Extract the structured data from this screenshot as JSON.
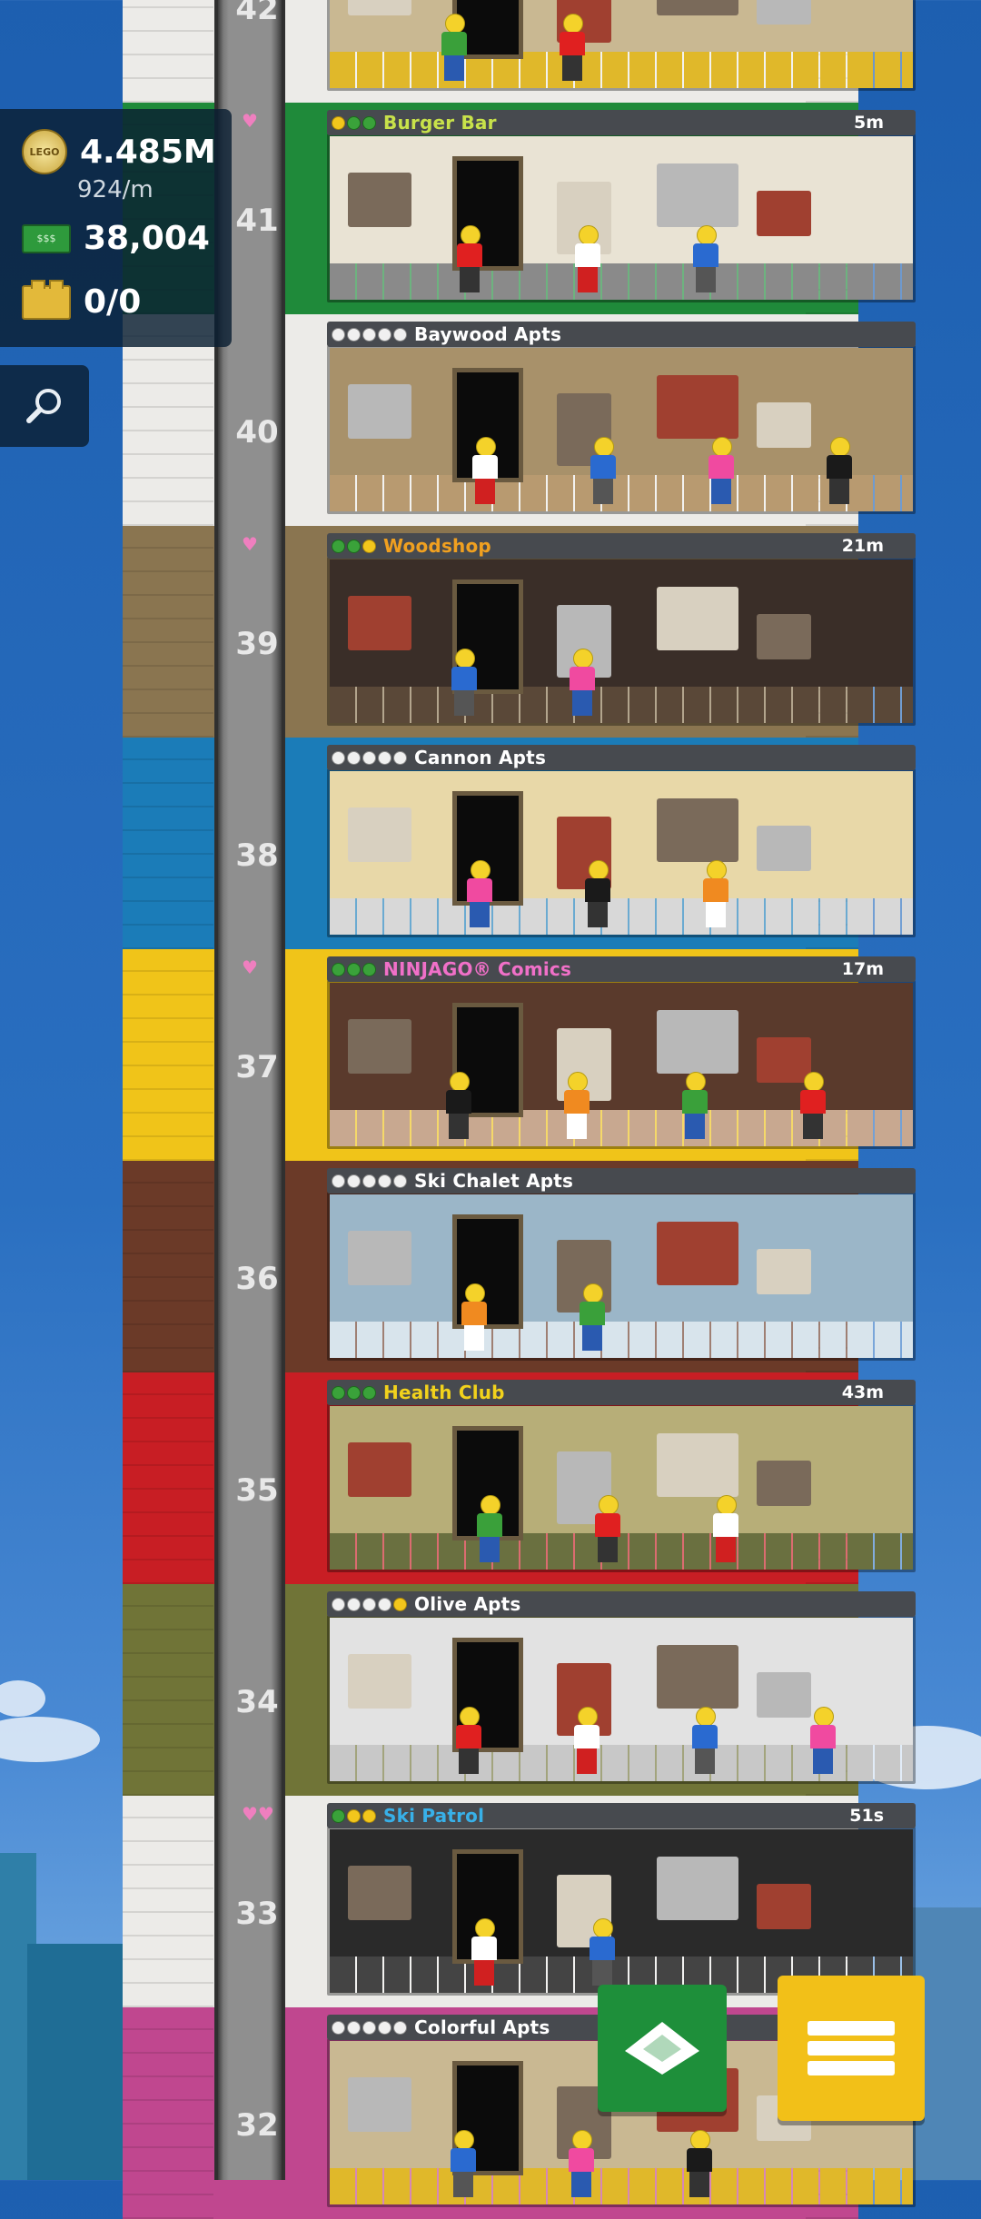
{
  "hud": {
    "coins": "4.485M",
    "coin_rate": "924/m",
    "bux": "38,004",
    "bricks": "0/0",
    "coin_icon_text": "LEGO",
    "bill_icon_text": "$$$"
  },
  "floors": [
    {
      "number": "42",
      "name": "",
      "timer": "",
      "stars": [],
      "theme": "white",
      "hearts": ""
    },
    {
      "number": "41",
      "name": "Burger Bar",
      "timer": "5m",
      "stars": [
        "y",
        "g",
        "g"
      ],
      "theme": "green",
      "name_color": "#c8e24a",
      "hearts": "♥"
    },
    {
      "number": "40",
      "name": "Baywood Apts",
      "timer": "",
      "stars": [
        "w",
        "w",
        "w",
        "w",
        "w"
      ],
      "theme": "white",
      "name_color": "#ffffff",
      "hearts": ""
    },
    {
      "number": "39",
      "name": "Woodshop",
      "timer": "21m",
      "stars": [
        "g",
        "g",
        "y"
      ],
      "theme": "tan",
      "name_color": "#f0a020",
      "hearts": "♥"
    },
    {
      "number": "38",
      "name": "Cannon Apts",
      "timer": "",
      "stars": [
        "w",
        "w",
        "w",
        "w",
        "w"
      ],
      "theme": "blue",
      "name_color": "#ffffff",
      "hearts": ""
    },
    {
      "number": "37",
      "name": "NINJAGO® Comics",
      "timer": "17m",
      "stars": [
        "g",
        "g",
        "g"
      ],
      "theme": "yellow",
      "name_color": "#f070c8",
      "hearts": "♥"
    },
    {
      "number": "36",
      "name": "Ski Chalet Apts",
      "timer": "",
      "stars": [
        "w",
        "w",
        "w",
        "w",
        "w"
      ],
      "theme": "brown",
      "name_color": "#ffffff",
      "hearts": ""
    },
    {
      "number": "35",
      "name": "Health Club",
      "timer": "43m",
      "stars": [
        "g",
        "g",
        "g"
      ],
      "theme": "red",
      "name_color": "#f2d21c",
      "hearts": ""
    },
    {
      "number": "34",
      "name": "Olive Apts",
      "timer": "",
      "stars": [
        "w",
        "w",
        "w",
        "w",
        "y"
      ],
      "theme": "olive",
      "name_color": "#ffffff",
      "hearts": ""
    },
    {
      "number": "33",
      "name": "Ski Patrol",
      "timer": "51s",
      "stars": [
        "g",
        "y",
        "y"
      ],
      "theme": "white",
      "name_color": "#38b0e8",
      "hearts": "♥♥"
    },
    {
      "number": "32",
      "name": "Colorful Apts",
      "timer": "",
      "stars": [
        "w",
        "w",
        "w",
        "w",
        "w"
      ],
      "theme": "pink",
      "name_color": "#ffffff",
      "hearts": ""
    }
  ],
  "themes": {
    "white": "#ecebe8",
    "green": "#1f8a3a",
    "tan": "#8a7550",
    "blue": "#1b7cb8",
    "yellow": "#f0c419",
    "brown": "#6b3a28",
    "red": "#c81e24",
    "olive": "#707437",
    "pink": "#c0478f"
  },
  "buttons": {
    "build": "build-button",
    "menu": "menu-button"
  }
}
